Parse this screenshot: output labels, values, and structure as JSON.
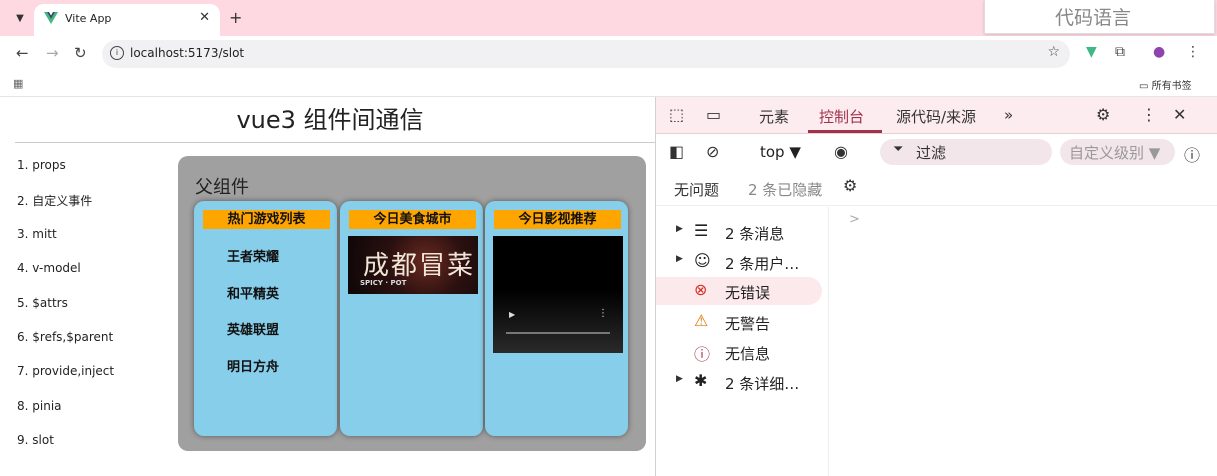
{
  "browser": {
    "tab_title": "Vite App",
    "url": "localhost:5173/slot",
    "bookmarks_folder": "所有书签",
    "overlay_text": "代码语言"
  },
  "page": {
    "title": "vue3 组件间通信",
    "nav": [
      "1. props",
      "2. 自定义事件",
      "3. mitt",
      "4. v-model",
      "5. $attrs",
      "6. $refs,$parent",
      "7. provide,inject",
      "8. pinia",
      "9. slot"
    ],
    "parent_title": "父组件",
    "categories": {
      "games": {
        "title": "热门游戏列表",
        "items": [
          "王者荣耀",
          "和平精英",
          "英雄联盟",
          "明日方舟"
        ]
      },
      "food": {
        "title": "今日美食城市",
        "image_text": "成都冒菜",
        "image_subtext": "SPICY · POT"
      },
      "video": {
        "title": "今日影视推荐"
      }
    }
  },
  "devtools": {
    "tabs": [
      "元素",
      "控制台",
      "源代码/来源"
    ],
    "active_tab": "控制台",
    "context": "top ▼",
    "filter_placeholder": "过滤",
    "level": "自定义级别 ▼",
    "issues": "无问题",
    "hidden": "2 条已隐藏",
    "sidebar": [
      {
        "label": "2 条消息",
        "icon": "list-icon"
      },
      {
        "label": "2 条用户…",
        "icon": "user-icon"
      },
      {
        "label": "无错误",
        "icon": "error-icon"
      },
      {
        "label": "无警告",
        "icon": "warning-icon"
      },
      {
        "label": "无信息",
        "icon": "info-icon"
      },
      {
        "label": "2 条详细…",
        "icon": "bug-icon"
      }
    ]
  },
  "colors": {
    "tabstrip": "#ffd9e2",
    "parent_bg": "#a0a0a0",
    "category_bg": "#87ceeb",
    "category_title_bg": "#ffa500",
    "devtools_accent": "#a0334a"
  }
}
